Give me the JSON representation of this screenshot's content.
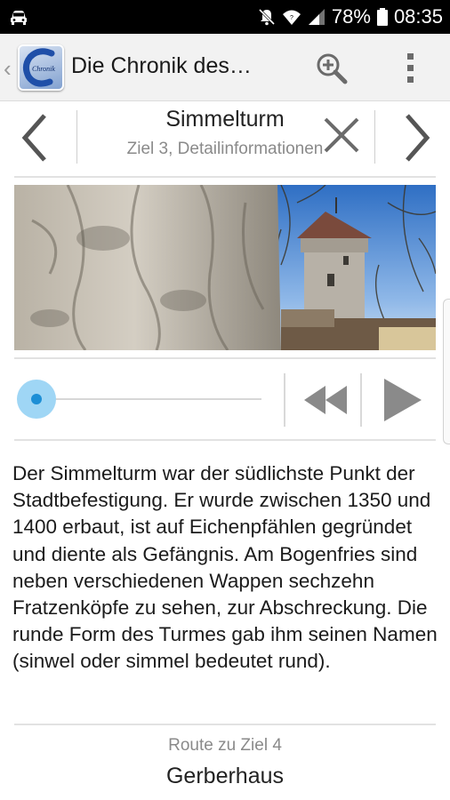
{
  "status_bar": {
    "battery_text": "78%",
    "time": "08:35",
    "icons": [
      "car-icon",
      "mute-icon",
      "wifi-icon",
      "signal-icon",
      "battery-icon"
    ]
  },
  "app_bar": {
    "logo_text": "Chronik",
    "title": "Die Chronik des…",
    "icons": [
      "back-chevron-icon",
      "zoom-in-icon",
      "overflow-menu-icon"
    ]
  },
  "stop": {
    "title": "Simmelturm",
    "subtitle": "Ziel 3, Detailinformationen"
  },
  "player": {
    "progress": 0.0,
    "accent_color": "#1d8fd6",
    "thumb_color": "#9fd6f5"
  },
  "description": "Der Simmelturm war der südlichste Punkt der Stadtbefestigung. Er wurde zwischen 1350 und 1400 erbaut, ist auf Eichenpfählen gegründet und diente als Gefängnis. Am Bogenfries sind neben verschiedenen Wappen sechzehn Fratzenköpfe zu sehen, zur Abschreckung. Die runde Form des Turmes gab ihm seinen Namen (sinwel oder simmel bedeutet rund).",
  "route": {
    "label": "Route zu Ziel 4",
    "destination": "Gerberhaus"
  }
}
